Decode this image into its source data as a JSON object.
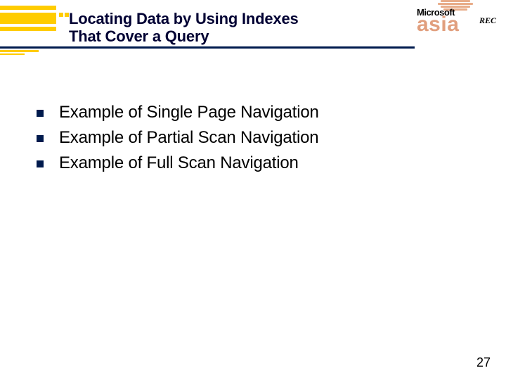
{
  "title_line1": "Locating Data by Using Indexes",
  "title_line2": "That Cover a Query",
  "logo": {
    "brand": "Microsoft",
    "sub": "asia",
    "badge": "REC"
  },
  "bullets": [
    "Example of Single Page Navigation",
    "Example of Partial Scan Navigation",
    "Example of Full Scan Navigation"
  ],
  "page_number": "27"
}
